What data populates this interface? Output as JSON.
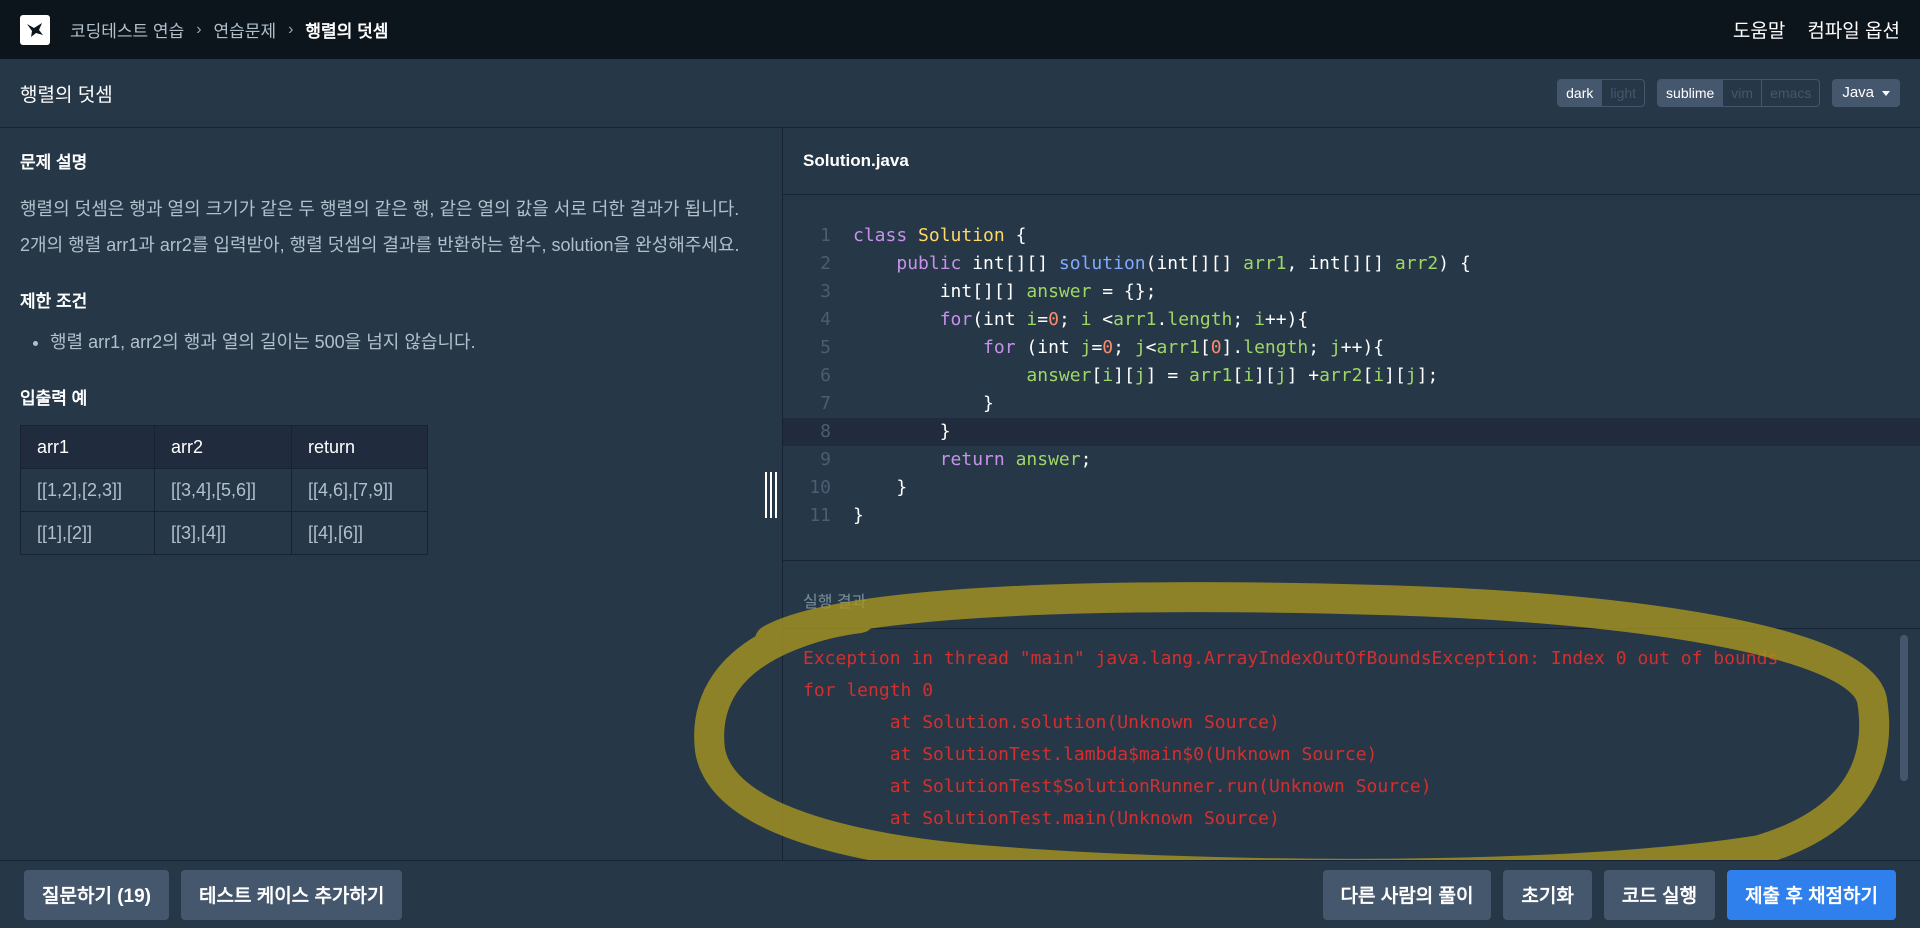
{
  "nav": {
    "crumbs": [
      "코딩테스트 연습",
      "연습문제",
      "행렬의 덧셈"
    ],
    "help": "도움말",
    "compile_options": "컴파일 옵션"
  },
  "header": {
    "title": "행렬의 덧셈",
    "theme": [
      "dark",
      "light"
    ],
    "keymap": [
      "sublime",
      "vim",
      "emacs"
    ],
    "language": "Java"
  },
  "problem": {
    "desc_title": "문제 설명",
    "desc": "행렬의 덧셈은 행과 열의 크기가 같은 두 행렬의 같은 행, 같은 열의 값을 서로 더한 결과가 됩니다. 2개의 행렬 arr1과 arr2를 입력받아, 행렬 덧셈의 결과를 반환하는 함수, solution을 완성해주세요.",
    "limit_title": "제한 조건",
    "limits": [
      "행렬 arr1, arr2의 행과 열의 길이는 500을 넘지 않습니다."
    ],
    "io_title": "입출력 예",
    "io_headers": [
      "arr1",
      "arr2",
      "return"
    ],
    "io_rows": [
      [
        "[[1,2],[2,3]]",
        "[[3,4],[5,6]]",
        "[[4,6],[7,9]]"
      ],
      [
        "[[1],[2]]",
        "[[3],[4]]",
        "[[4],[6]]"
      ]
    ]
  },
  "editor": {
    "filename": "Solution.java",
    "highlight_line": 8,
    "lines": [
      [
        [
          "kw",
          "class "
        ],
        [
          "cls",
          "Solution"
        ],
        [
          "txt",
          " {"
        ]
      ],
      [
        [
          "txt",
          "    "
        ],
        [
          "kw",
          "public "
        ],
        [
          "txt",
          "int[][] "
        ],
        [
          "fn",
          "solution"
        ],
        [
          "txt",
          "(int[][] "
        ],
        [
          "var",
          "arr1"
        ],
        [
          "txt",
          ", int[][] "
        ],
        [
          "var",
          "arr2"
        ],
        [
          "txt",
          ") {"
        ]
      ],
      [
        [
          "txt",
          "        int[][] "
        ],
        [
          "var",
          "answer"
        ],
        [
          "txt",
          " = {};"
        ]
      ],
      [
        [
          "txt",
          "        "
        ],
        [
          "kw",
          "for"
        ],
        [
          "txt",
          "(int "
        ],
        [
          "var",
          "i"
        ],
        [
          "txt",
          "="
        ],
        [
          "num",
          "0"
        ],
        [
          "txt",
          "; "
        ],
        [
          "var",
          "i"
        ],
        [
          "txt",
          " <"
        ],
        [
          "var",
          "arr1"
        ],
        [
          "txt",
          "."
        ],
        [
          "var",
          "length"
        ],
        [
          "txt",
          "; "
        ],
        [
          "var",
          "i"
        ],
        [
          "txt",
          "++){"
        ]
      ],
      [
        [
          "txt",
          "            "
        ],
        [
          "kw",
          "for"
        ],
        [
          "txt",
          " (int "
        ],
        [
          "var",
          "j"
        ],
        [
          "txt",
          "="
        ],
        [
          "num",
          "0"
        ],
        [
          "txt",
          "; "
        ],
        [
          "var",
          "j"
        ],
        [
          "txt",
          "<"
        ],
        [
          "var",
          "arr1"
        ],
        [
          "txt",
          "["
        ],
        [
          "num",
          "0"
        ],
        [
          "txt",
          "]."
        ],
        [
          "var",
          "length"
        ],
        [
          "txt",
          "; "
        ],
        [
          "var",
          "j"
        ],
        [
          "txt",
          "++){"
        ]
      ],
      [
        [
          "txt",
          "                "
        ],
        [
          "var",
          "answer"
        ],
        [
          "txt",
          "["
        ],
        [
          "var",
          "i"
        ],
        [
          "txt",
          "]["
        ],
        [
          "var",
          "j"
        ],
        [
          "txt",
          "] = "
        ],
        [
          "var",
          "arr1"
        ],
        [
          "txt",
          "["
        ],
        [
          "var",
          "i"
        ],
        [
          "txt",
          "]["
        ],
        [
          "var",
          "j"
        ],
        [
          "txt",
          "] +"
        ],
        [
          "var",
          "arr2"
        ],
        [
          "txt",
          "["
        ],
        [
          "var",
          "i"
        ],
        [
          "txt",
          "]["
        ],
        [
          "var",
          "j"
        ],
        [
          "txt",
          "];"
        ]
      ],
      [
        [
          "txt",
          "            }"
        ]
      ],
      [
        [
          "txt",
          "        }"
        ]
      ],
      [
        [
          "txt",
          "        "
        ],
        [
          "kw",
          "return "
        ],
        [
          "var",
          "answer"
        ],
        [
          "txt",
          ";"
        ]
      ],
      [
        [
          "txt",
          "    }"
        ]
      ],
      [
        [
          "txt",
          "}"
        ]
      ]
    ]
  },
  "results": {
    "title": "실행 결과",
    "output": "Exception in thread \"main\" java.lang.ArrayIndexOutOfBoundsException: Index 0 out of bounds\nfor length 0\n        at Solution.solution(Unknown Source)\n        at SolutionTest.lambda$main$0(Unknown Source)\n        at SolutionTest$SolutionRunner.run(Unknown Source)\n        at SolutionTest.main(Unknown Source)"
  },
  "bottom": {
    "ask": "질문하기 (19)",
    "add_testcase": "테스트 케이스 추가하기",
    "others": "다른 사람의 풀이",
    "reset": "초기화",
    "run": "코드 실행",
    "submit": "제출 후 채점하기"
  },
  "annotation_color": "#a89520"
}
